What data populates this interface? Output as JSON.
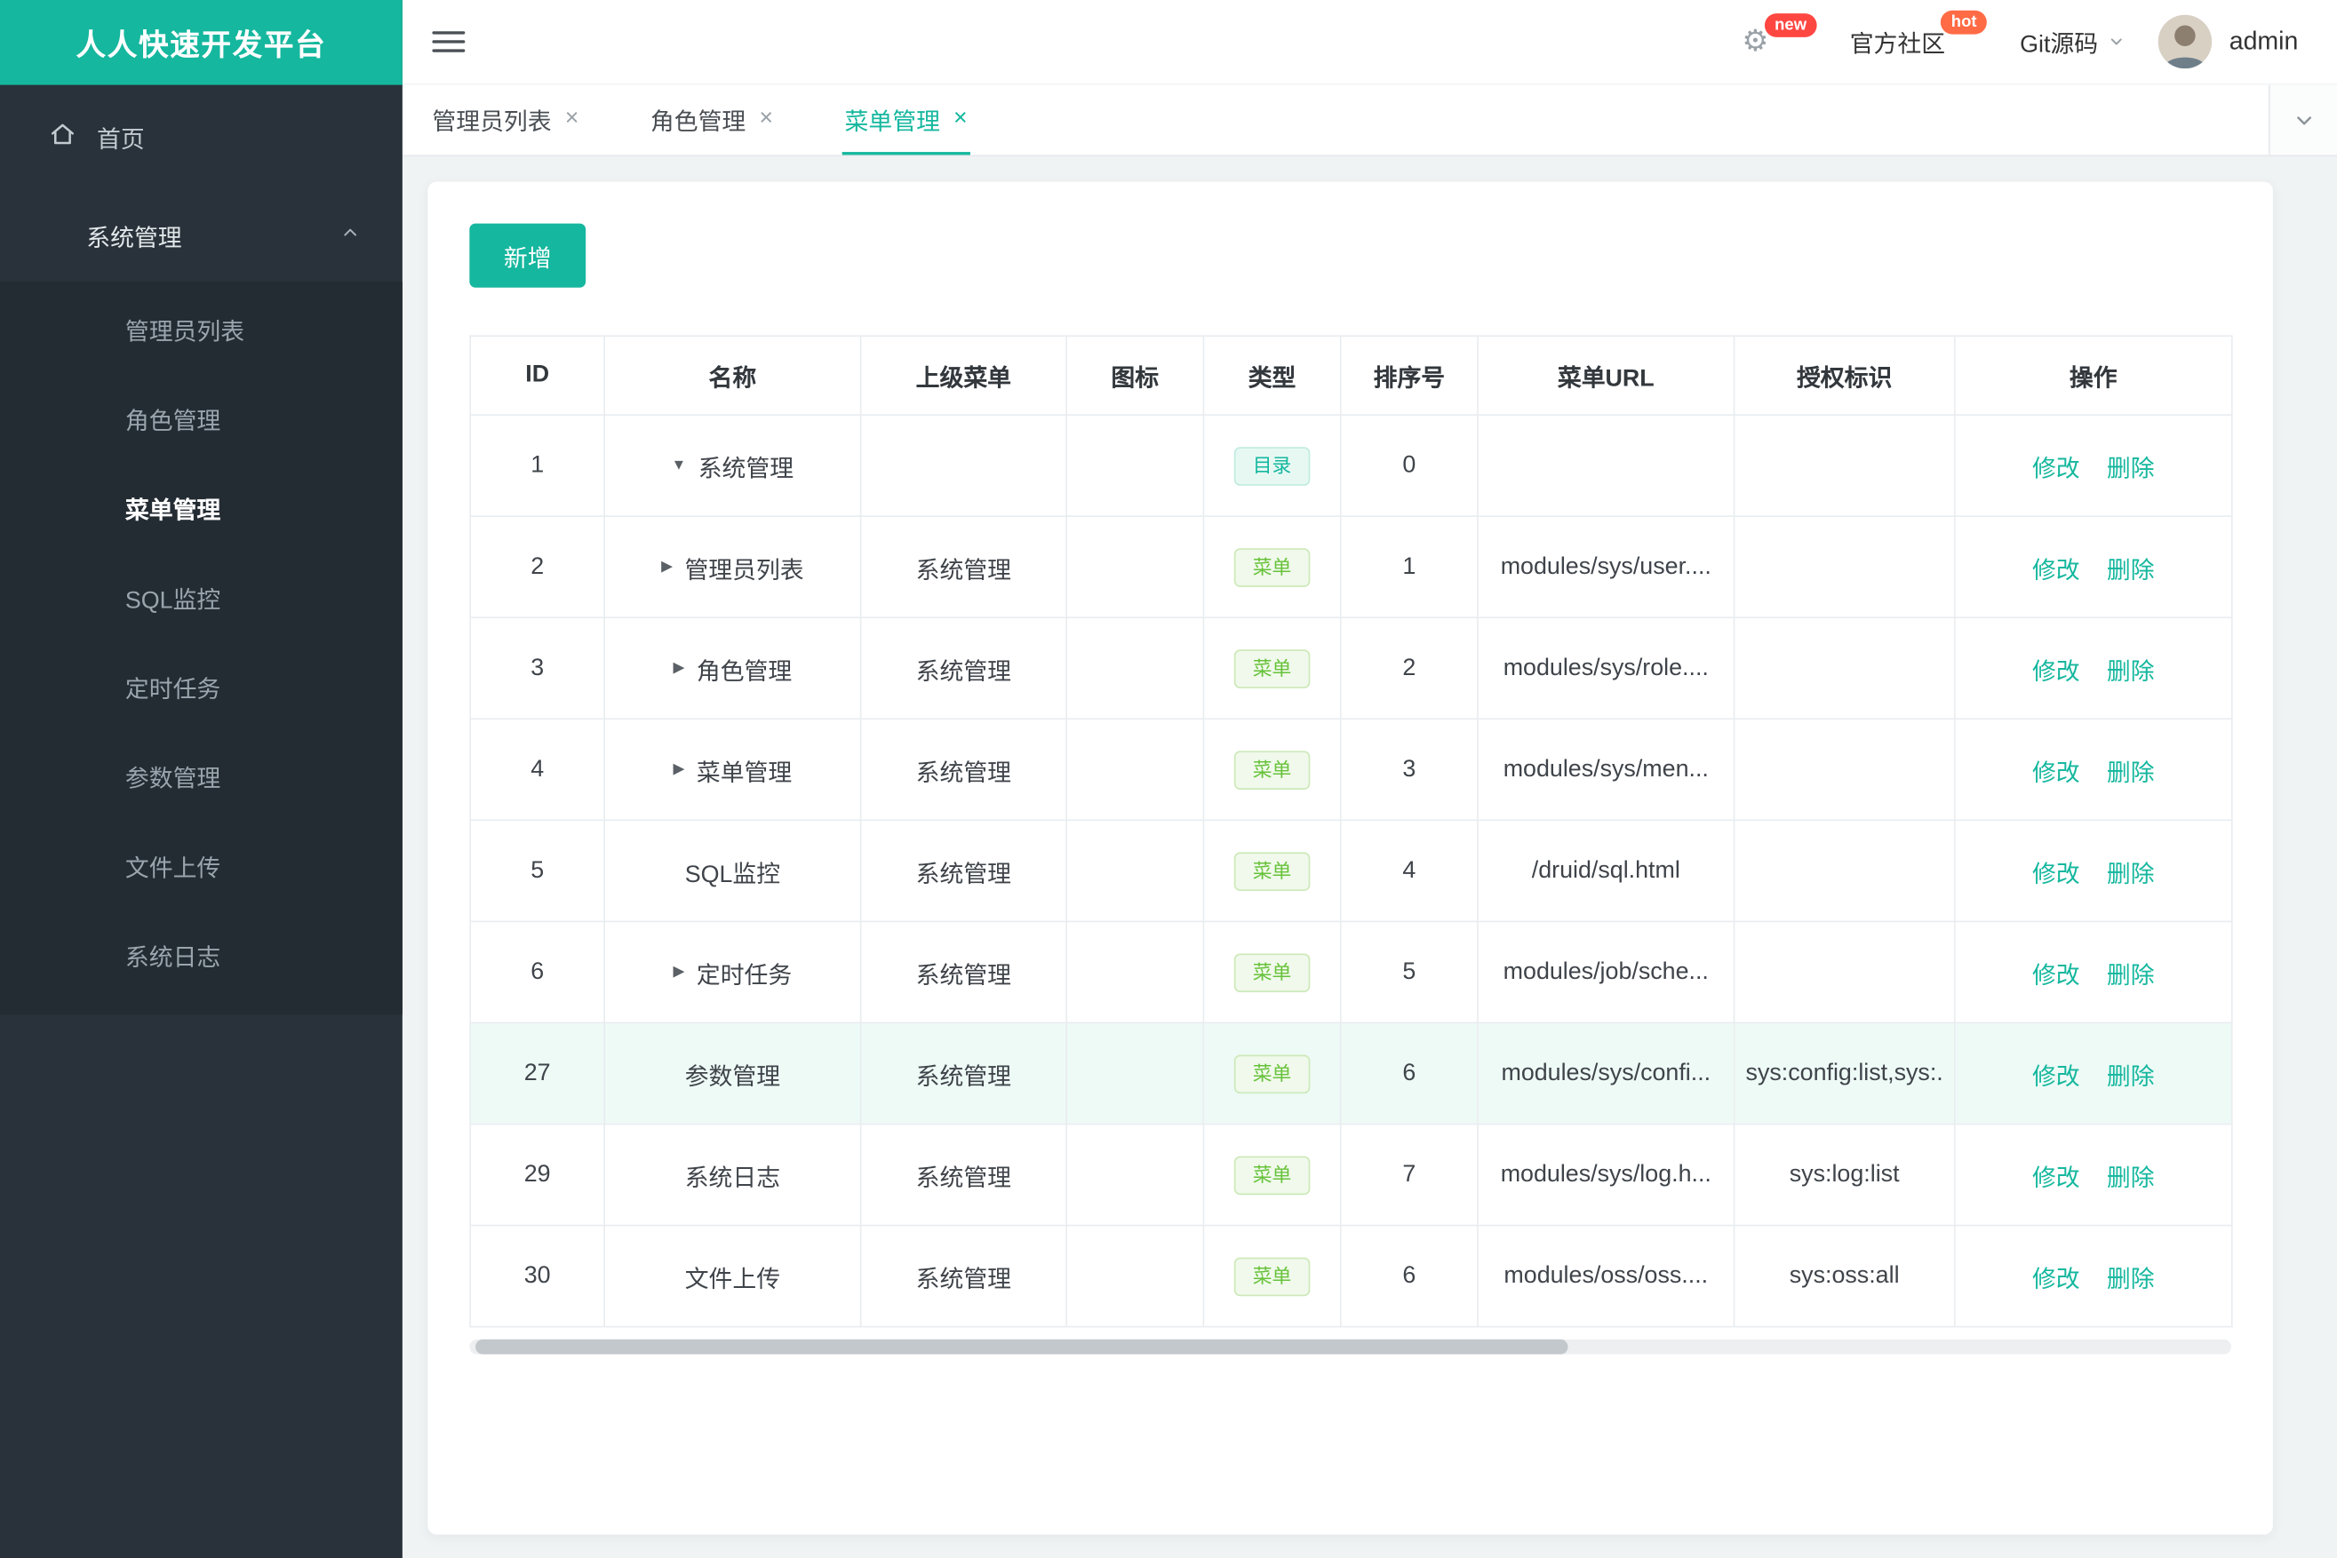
{
  "app": {
    "title": "人人快速开发平台"
  },
  "topbar": {
    "new_badge": "new",
    "community_label": "官方社区",
    "hot_badge": "hot",
    "git_label": "Git源码",
    "username": "admin"
  },
  "sidebar": {
    "home_label": "首页",
    "group_label": "系统管理",
    "items": [
      "管理员列表",
      "角色管理",
      "菜单管理",
      "SQL监控",
      "定时任务",
      "参数管理",
      "文件上传",
      "系统日志"
    ],
    "active_item": "菜单管理"
  },
  "tabs": {
    "items": [
      {
        "label": "管理员列表",
        "active": false
      },
      {
        "label": "角色管理",
        "active": false
      },
      {
        "label": "菜单管理",
        "active": true
      }
    ]
  },
  "toolbar": {
    "add_label": "新增"
  },
  "table": {
    "headers": [
      "ID",
      "名称",
      "上级菜单",
      "图标",
      "类型",
      "排序号",
      "菜单URL",
      "授权标识",
      "操作"
    ],
    "action_edit": "修改",
    "action_delete": "删除",
    "rows": [
      {
        "id": "1",
        "arrow": "down",
        "name": "系统管理",
        "parent": "",
        "icon": "",
        "type": "目录",
        "kind": "dir",
        "order": "0",
        "url": "",
        "perm": "",
        "highlight": false
      },
      {
        "id": "2",
        "arrow": "right",
        "name": "管理员列表",
        "parent": "系统管理",
        "icon": "",
        "type": "菜单",
        "kind": "menu",
        "order": "1",
        "url": "modules/sys/user....",
        "perm": "",
        "highlight": false
      },
      {
        "id": "3",
        "arrow": "right",
        "name": "角色管理",
        "parent": "系统管理",
        "icon": "",
        "type": "菜单",
        "kind": "menu",
        "order": "2",
        "url": "modules/sys/role....",
        "perm": "",
        "highlight": false
      },
      {
        "id": "4",
        "arrow": "right",
        "name": "菜单管理",
        "parent": "系统管理",
        "icon": "",
        "type": "菜单",
        "kind": "menu",
        "order": "3",
        "url": "modules/sys/men...",
        "perm": "",
        "highlight": false
      },
      {
        "id": "5",
        "arrow": "",
        "name": "SQL监控",
        "parent": "系统管理",
        "icon": "",
        "type": "菜单",
        "kind": "menu",
        "order": "4",
        "url": "/druid/sql.html",
        "perm": "",
        "highlight": false
      },
      {
        "id": "6",
        "arrow": "right",
        "name": "定时任务",
        "parent": "系统管理",
        "icon": "",
        "type": "菜单",
        "kind": "menu",
        "order": "5",
        "url": "modules/job/sche...",
        "perm": "",
        "highlight": false
      },
      {
        "id": "27",
        "arrow": "",
        "name": "参数管理",
        "parent": "系统管理",
        "icon": "",
        "type": "菜单",
        "kind": "menu",
        "order": "6",
        "url": "modules/sys/confi...",
        "perm": "sys:config:list,sys:.",
        "highlight": true
      },
      {
        "id": "29",
        "arrow": "",
        "name": "系统日志",
        "parent": "系统管理",
        "icon": "",
        "type": "菜单",
        "kind": "menu",
        "order": "7",
        "url": "modules/sys/log.h...",
        "perm": "sys:log:list",
        "highlight": false
      },
      {
        "id": "30",
        "arrow": "",
        "name": "文件上传",
        "parent": "系统管理",
        "icon": "",
        "type": "菜单",
        "kind": "menu",
        "order": "6",
        "url": "modules/oss/oss....",
        "perm": "sys:oss:all",
        "highlight": false
      }
    ]
  },
  "colors": {
    "accent": "#15b79e",
    "tag_menu_green": "#67c23a",
    "badge_new": "#ff4742",
    "badge_hot": "#ff6b45",
    "sidebar_bg": "#29323a"
  }
}
